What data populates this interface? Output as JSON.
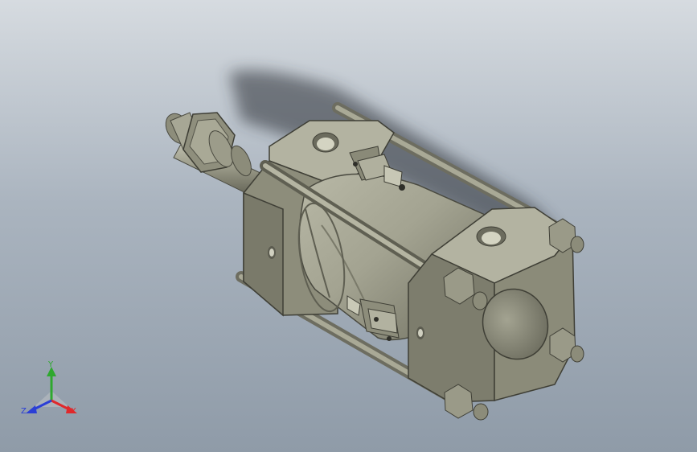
{
  "viewport": {
    "background_top": "#d6dbe0",
    "background_bottom": "#8f9ba8",
    "model": "pneumatic-cylinder",
    "model_color": "#9a9a87"
  },
  "triad": {
    "x_label": "X",
    "y_label": "Y",
    "z_label": "Z",
    "x_color": "#e0282b",
    "y_color": "#2ea82e",
    "z_color": "#2b3fd6"
  }
}
